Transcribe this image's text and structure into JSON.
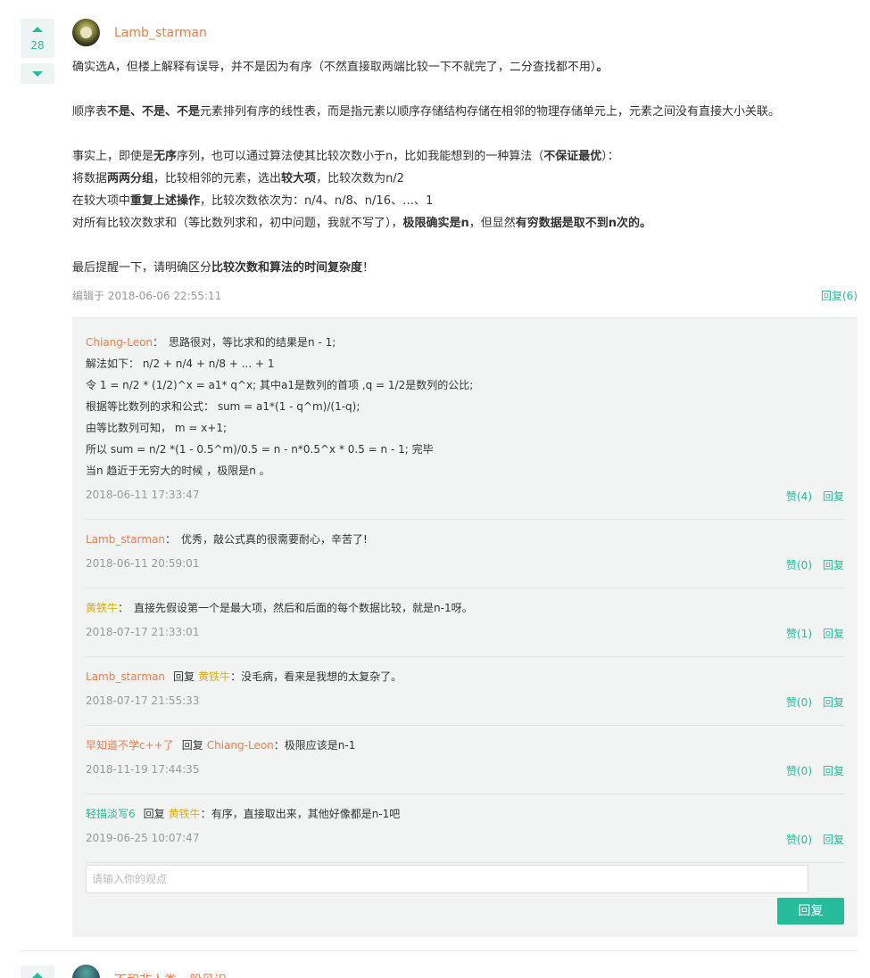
{
  "answer": {
    "vote_count": "28",
    "username": "Lamb_starman",
    "paragraphs": [
      [
        {
          "t": "确实选A，但楼上解释有误导，并不是因为有序（不然直接取两端比较一下不就完了，二分查找都不用）",
          "b": false
        },
        {
          "t": "。",
          "b": true
        }
      ],
      [],
      [
        {
          "t": "顺序表",
          "b": false
        },
        {
          "t": "不是、不是、不是",
          "b": true
        },
        {
          "t": "元素排列有序的线性表，而是指元素以顺序存储结构存储在相邻的物理存储单元上，元素之间没有直接大小关联。",
          "b": false
        }
      ],
      [],
      [
        {
          "t": "事实上，即使是",
          "b": false
        },
        {
          "t": "无序",
          "b": true
        },
        {
          "t": "序列，也可以通过算法使其比较次数小于n，比如我能想到的一种算法（",
          "b": false
        },
        {
          "t": "不保证最优",
          "b": true
        },
        {
          "t": "）：",
          "b": false
        }
      ],
      [
        {
          "t": "将数据",
          "b": false
        },
        {
          "t": "两两分组",
          "b": true
        },
        {
          "t": "，比较相邻的元素，选出",
          "b": false
        },
        {
          "t": "较大项",
          "b": true
        },
        {
          "t": "，比较次数为n/2",
          "b": false
        }
      ],
      [
        {
          "t": "在较大项中",
          "b": false
        },
        {
          "t": "重复上述操作",
          "b": true
        },
        {
          "t": "，比较次数依次为：n/4、n/8、n/16、…、1",
          "b": false
        }
      ],
      [
        {
          "t": "对所有比较次数求和（等比数列求和，初中问题，我就不写了），",
          "b": false
        },
        {
          "t": "极限确实是n",
          "b": true
        },
        {
          "t": "，但显然",
          "b": false
        },
        {
          "t": "有穷数据是取不到n次的。",
          "b": true
        }
      ],
      [],
      [
        {
          "t": "最后提醒一下，请明确区分",
          "b": false
        },
        {
          "t": "比较次数和算法的时间复杂度",
          "b": true
        },
        {
          "t": "！",
          "b": false
        }
      ]
    ],
    "edit_meta": "编辑于 2018-06-06 22:55:11",
    "reply_count_label": "回复(6)"
  },
  "replies": [
    {
      "user": "Chiang-Leon",
      "user_color": "orange",
      "reply_to": "",
      "lines": [
        "思路很对，等比求和的结果是n - 1;",
        "解法如下： n/2 + n/4 + n/8 + ... + 1",
        "令 1 = n/2 * (1/2)^x = a1* q^x; 其中a1是数列的首项 ,q = 1/2是数列的公比;",
        "根据等比数列的求和公式： sum = a1*(1 - q^m)/(1-q);",
        "由等比数列可知， m = x+1;",
        "所以 sum = n/2 *(1 - 0.5^m)/0.5 = n - n*0.5^x * 0.5 = n - 1; 完毕",
        "当n 趋近于无穷大的时候 ，极限是n 。"
      ],
      "time": "2018-06-11 17:33:47",
      "like": "赞(4)",
      "reply_label": "回复"
    },
    {
      "user": "Lamb_starman",
      "user_color": "orange",
      "reply_to": "",
      "lines": [
        "优秀，敲公式真的很需要耐心，辛苦了!"
      ],
      "time": "2018-06-11 20:59:01",
      "like": "赞(0)",
      "reply_label": "回复"
    },
    {
      "user": "黄铁牛",
      "user_color": "gold",
      "reply_to": "",
      "lines": [
        "直接先假设第一个是最大项，然后和后面的每个数据比较，就是n-1呀。"
      ],
      "time": "2018-07-17 21:33:01",
      "like": "赞(1)",
      "reply_label": "回复"
    },
    {
      "user": "Lamb_starman",
      "user_color": "orange",
      "reply_to": "黄铁牛",
      "reply_to_color": "gold",
      "lines": [
        "没毛病，看来是我想的太复杂了。"
      ],
      "time": "2018-07-17 21:55:33",
      "like": "赞(0)",
      "reply_label": "回复"
    },
    {
      "user": "早知道不学c++了",
      "user_color": "orange",
      "reply_to": "Chiang-Leon",
      "reply_to_color": "orange",
      "lines": [
        "极限应该是n-1"
      ],
      "time": "2018-11-19 17:44:35",
      "like": "赞(0)",
      "reply_label": "回复"
    },
    {
      "user": "轻描淡写6",
      "user_color": "green",
      "reply_to": "黄铁牛",
      "reply_to_color": "gold",
      "lines": [
        "有序，直接取出来，其他好像都是n-1吧"
      ],
      "time": "2019-06-25 10:07:47",
      "like": "赞(0)",
      "reply_label": "回复"
    }
  ],
  "reply_box": {
    "placeholder": "请输入你的观点",
    "submit_label": "回复"
  },
  "labels": {
    "reply_word": "回复",
    "colon": "："
  },
  "next_answer": {
    "username": "不和非人类一般见识"
  }
}
